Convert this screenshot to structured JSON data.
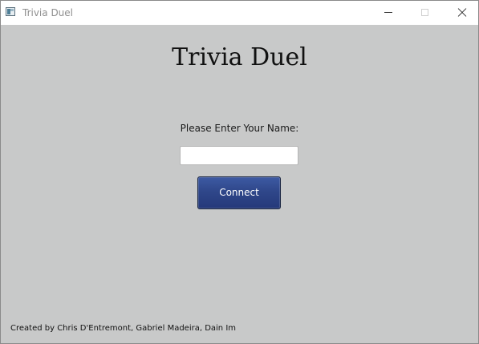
{
  "window": {
    "title": "Trivia Duel",
    "icon": "app-window-icon",
    "controls": [
      "minimize-icon",
      "maximize-icon",
      "close-icon"
    ]
  },
  "main": {
    "title": "Trivia Duel",
    "name_label": "Please Enter Your Name:",
    "name_input": {
      "value": "",
      "placeholder": ""
    },
    "connect_label": "Connect"
  },
  "footer": {
    "credits": "Created by Chris D'Entremont, Gabriel Madeira, Dain Im"
  },
  "colors": {
    "background": "#c8c9c9",
    "titlebar": "#ffffff",
    "button": "#2f478a",
    "button_text": "#ffffff"
  }
}
